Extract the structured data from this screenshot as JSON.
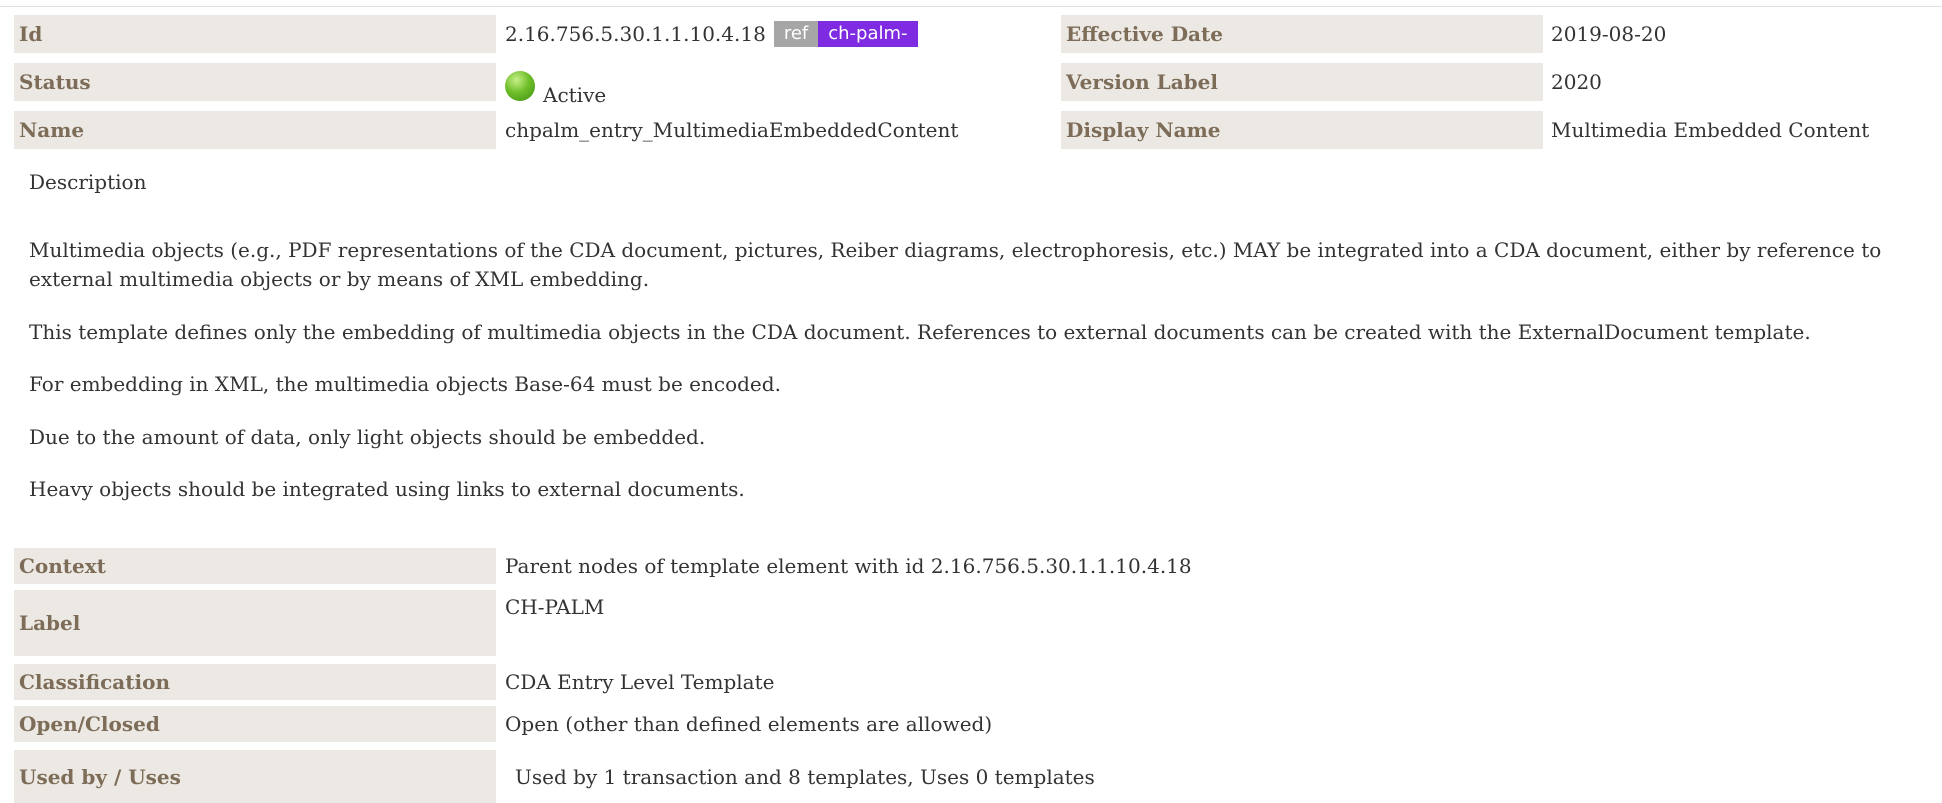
{
  "header": {
    "id_label": "Id",
    "id_value": "2.16.756.5.30.1.1.10.4.18",
    "ref_badge": "ref",
    "prefix_badge": "ch-palm-",
    "effective_date_label": "Effective Date",
    "effective_date_value": "2019-08-20",
    "status_label": "Status",
    "status_value": "Active",
    "version_label_label": "Version Label",
    "version_label_value": "2020",
    "name_label": "Name",
    "name_value": "chpalm_entry_MultimediaEmbeddedContent",
    "display_name_label": "Display Name",
    "display_name_value": "Multimedia Embedded Content"
  },
  "description": {
    "title": "Description",
    "paragraphs": [
      "Multimedia objects (e.g., PDF representations of the CDA document, pictures, Reiber diagrams, electrophoresis, etc.) MAY be integrated into a CDA document, either by reference to external multimedia objects or by means of XML embedding.",
      "This template defines only the embedding of multimedia objects in the CDA document. References to external documents can be created with the ExternalDocument template.",
      "For embedding in XML, the multimedia objects Base-64 must be encoded.",
      "Due to the amount of data, only light objects should be embedded.",
      "Heavy objects should be integrated using links to external documents."
    ]
  },
  "details": {
    "context_label": "Context",
    "context_value": "Parent nodes of template element with id 2.16.756.5.30.1.1.10.4.18",
    "label_label": "Label",
    "label_value": "CH-PALM",
    "classification_label": "Classification",
    "classification_value": "CDA Entry Level Template",
    "open_closed_label": "Open/Closed",
    "open_closed_value": "Open (other than defined elements are allowed)",
    "used_by_label": "Used by / Uses",
    "used_by_value": "Used by 1 transaction and 8 templates, Uses 0 templates"
  },
  "colors": {
    "label_bg": "#ece9e4",
    "label_text": "#7d6c57",
    "ref_badge": "#a6a6a6",
    "prefix_badge": "#7f2be1",
    "status_active": "#6fbf2a"
  },
  "icons": {
    "status": "green-circle-icon"
  }
}
